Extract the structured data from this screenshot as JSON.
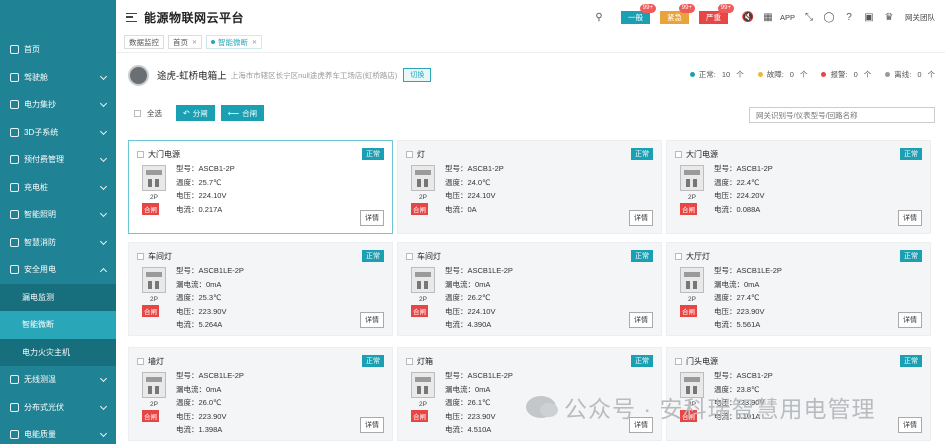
{
  "app": {
    "title": "能源物联网云平台"
  },
  "sidebar": {
    "items": [
      {
        "label": "首页",
        "icon": "monitor-icon",
        "expandable": false
      },
      {
        "label": "驾驶舱",
        "icon": "dashboard-icon",
        "expandable": true
      },
      {
        "label": "电力集抄",
        "icon": "meter-icon",
        "expandable": true
      },
      {
        "label": "3D子系统",
        "icon": "cube-icon",
        "expandable": true
      },
      {
        "label": "预付费管理",
        "icon": "prepaid-icon",
        "expandable": true
      },
      {
        "label": "充电桩",
        "icon": "charger-icon",
        "expandable": true
      },
      {
        "label": "智能照明",
        "icon": "bulb-icon",
        "expandable": true
      },
      {
        "label": "智慧消防",
        "icon": "fire-icon",
        "expandable": true
      },
      {
        "label": "安全用电",
        "icon": "safety-icon",
        "expandable": true,
        "open": true,
        "children": [
          {
            "label": "漏电监测",
            "active": false
          },
          {
            "label": "智能微断",
            "active": true
          },
          {
            "label": "电力火灾主机",
            "active": false
          }
        ]
      },
      {
        "label": "无线测温",
        "icon": "thermometer-icon",
        "expandable": true
      },
      {
        "label": "分布式光伏",
        "icon": "solar-icon",
        "expandable": true
      },
      {
        "label": "电能质量",
        "icon": "quality-icon",
        "expandable": true
      }
    ]
  },
  "header": {
    "alarms": [
      {
        "label": "一般",
        "count": "99+",
        "color": "#1b9fb3"
      },
      {
        "label": "紧急",
        "count": "99+",
        "color": "#e8a33a"
      },
      {
        "label": "严重",
        "count": "99+",
        "color": "#e84545"
      }
    ],
    "app_label": "APP",
    "gateway_label": "网关团队"
  },
  "tabs": [
    {
      "label": "数据监控",
      "closable": false,
      "active": false
    },
    {
      "label": "首页",
      "closable": true,
      "active": false
    },
    {
      "label": "智能微断",
      "closable": true,
      "active": true
    }
  ],
  "info": {
    "owner": "途虎-虹桥电箱上",
    "address": "上海市市辖区长宁区null途虎养车工场店(虹桥路店)",
    "switch_label": "切换",
    "stats": [
      {
        "label": "正常:",
        "value": "10",
        "unit": "个",
        "color": "#1b9fb3"
      },
      {
        "label": "故障:",
        "value": "0",
        "unit": "个",
        "color": "#e8b93a"
      },
      {
        "label": "报警:",
        "value": "0",
        "unit": "个",
        "color": "#e84545"
      },
      {
        "label": "离线:",
        "value": "0",
        "unit": "个",
        "color": "#999999"
      }
    ]
  },
  "toolbar": {
    "select_all": "全选",
    "open_label": "分闸",
    "close_label": "合闸",
    "search_placeholder": "网关识别号/仪表型号/回路名称"
  },
  "common": {
    "status": "正常",
    "detail": "详情",
    "pole": "2P",
    "state": "合闸"
  },
  "cards": [
    {
      "name": "大门电源",
      "model": "型号：ASCB1-2P",
      "leak": "",
      "temp": "温度：25.7℃",
      "volt": "电压：224.10V",
      "curr": "电流：0.217A",
      "selected": true
    },
    {
      "name": "灯",
      "model": "型号：ASCB1-2P",
      "leak": "",
      "temp": "温度：24.0℃",
      "volt": "电压：224.10V",
      "curr": "电流：0A"
    },
    {
      "name": "大门电源",
      "model": "型号：ASCB1-2P",
      "leak": "",
      "temp": "温度：22.4℃",
      "volt": "电压：224.20V",
      "curr": "电流：0.088A"
    },
    {
      "name": "车间灯",
      "model": "型号：ASCB1LE-2P",
      "leak": "漏电流：0mA",
      "temp": "温度：25.3℃",
      "volt": "电压：223.90V",
      "curr": "电流：5.264A"
    },
    {
      "name": "车间灯",
      "model": "型号：ASCB1LE-2P",
      "leak": "漏电流：0mA",
      "temp": "温度：26.2℃",
      "volt": "电压：224.10V",
      "curr": "电流：4.390A"
    },
    {
      "name": "大厅灯",
      "model": "型号：ASCB1LE-2P",
      "leak": "漏电流：0mA",
      "temp": "温度：27.4℃",
      "volt": "电压：223.90V",
      "curr": "电流：5.561A"
    },
    {
      "name": "墙灯",
      "model": "型号：ASCB1LE-2P",
      "leak": "漏电流：0mA",
      "temp": "温度：26.0℃",
      "volt": "电压：223.90V",
      "curr": "电流：1.398A"
    },
    {
      "name": "灯箱",
      "model": "型号：ASCB1LE-2P",
      "leak": "漏电流：0mA",
      "temp": "温度：26.1℃",
      "volt": "电压：223.90V",
      "curr": "电流：4.510A"
    },
    {
      "name": "门头电源",
      "model": "型号：ASCB1-2P",
      "leak": "",
      "temp": "温度：23.8℃",
      "volt": "电压：223.90V",
      "curr": "电流：0.101A"
    }
  ],
  "watermark": "公众号 · 安科瑞智慧用电管理"
}
